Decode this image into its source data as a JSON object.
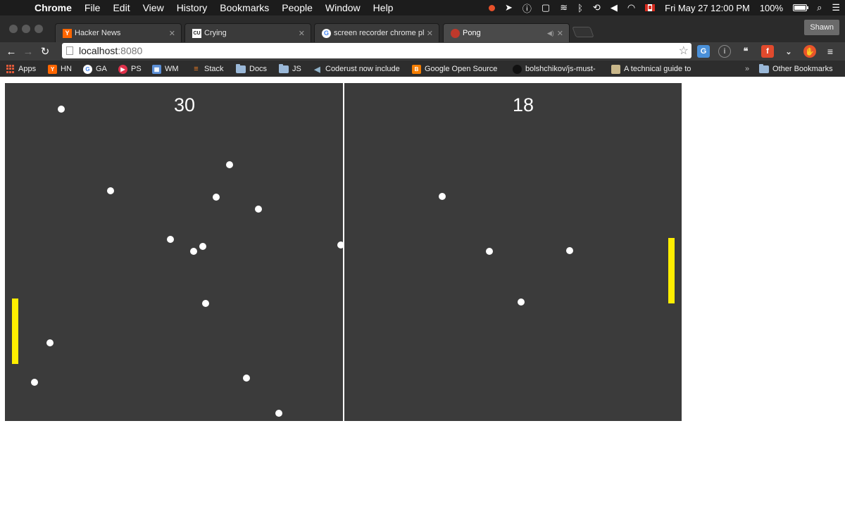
{
  "menubar": {
    "app_name": "Chrome",
    "menus": [
      "File",
      "Edit",
      "View",
      "History",
      "Bookmarks",
      "People",
      "Window",
      "Help"
    ],
    "clock": "Fri May 27  12:00 PM",
    "battery": "100%"
  },
  "tabs": [
    {
      "title": "Hacker News",
      "icon": "hacker-news-icon",
      "active": false
    },
    {
      "title": "Crying",
      "icon": "crying-icon",
      "active": false
    },
    {
      "title": "screen recorder chrome plu",
      "icon": "google-icon",
      "active": false
    },
    {
      "title": "Pong",
      "icon": "pong-icon",
      "active": true
    }
  ],
  "profile": "Shawn",
  "omnibox": {
    "host": "localhost",
    "port": ":8080"
  },
  "bookmarks": [
    {
      "label": "Apps",
      "icon": "apps-icon"
    },
    {
      "label": "HN",
      "icon": "hacker-news-icon"
    },
    {
      "label": "GA",
      "icon": "google-icon"
    },
    {
      "label": "PS",
      "icon": "ps-icon"
    },
    {
      "label": "WM",
      "icon": "wm-icon"
    },
    {
      "label": "Stack",
      "icon": "stack-icon"
    },
    {
      "label": "Docs",
      "icon": "folder-icon"
    },
    {
      "label": "JS",
      "icon": "folder-icon"
    },
    {
      "label": "Coderust now include",
      "icon": "coderust-icon"
    },
    {
      "label": "Google Open Source",
      "icon": "blogger-icon"
    },
    {
      "label": "bolshchikov/js-must-",
      "icon": "github-icon"
    },
    {
      "label": "A technical guide to",
      "icon": "avatar-icon"
    },
    {
      "label": "Other Bookmarks",
      "icon": "folder-icon"
    }
  ],
  "game": {
    "left_score": "30",
    "right_score": "18",
    "paddle_color": "#ffee00",
    "background_color": "#3b3b3b",
    "ball_color": "#ffffff"
  }
}
